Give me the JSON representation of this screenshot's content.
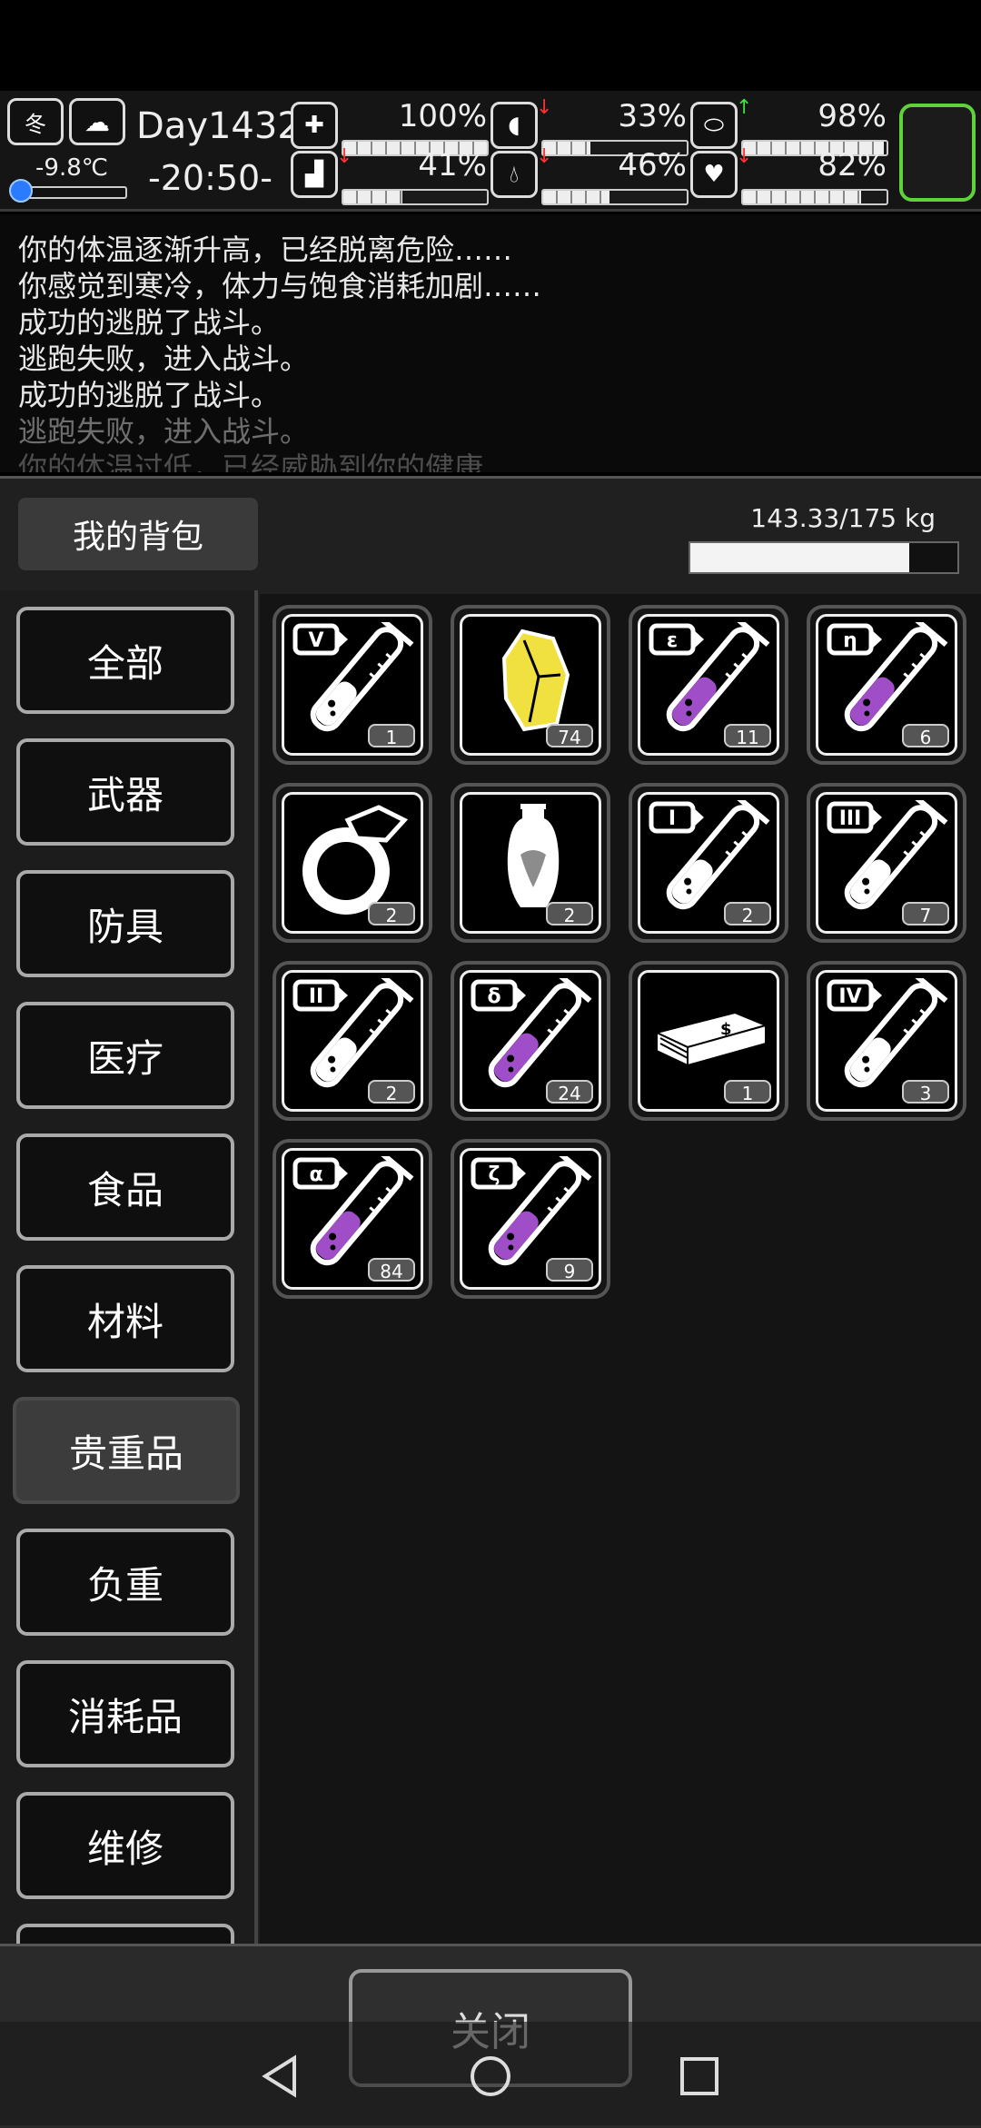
{
  "status": {
    "season_icon": "冬",
    "weather_icon": "cloud-icon",
    "temperature": "-9.8℃",
    "day": "Day1432",
    "time": "-20:50-",
    "health": "100%",
    "hunger": "33%",
    "mood": "98%",
    "stamina": "41%",
    "thirst": "46%",
    "heart": "82%",
    "health_level": 1.0,
    "hunger_level": 0.33,
    "mood_level": 0.98,
    "stamina_level": 0.41,
    "thirst_level": 0.46,
    "heart_level": 0.82
  },
  "log": [
    "你的体温逐渐升高，已经脱离危险……",
    "你感觉到寒冷，体力与饱食消耗加剧……",
    "成功的逃脱了战斗。",
    "逃跑失败，进入战斗。",
    "成功的逃脱了战斗。",
    "逃跑失败，进入战斗。",
    "你的体温过低，已经威胁到你的健康"
  ],
  "bag": {
    "title": "我的背包",
    "weight": "143.33/175 kg",
    "weight_level": 0.82
  },
  "categories": [
    "全部",
    "武器",
    "防具",
    "医疗",
    "食品",
    "材料",
    "贵重品",
    "负重",
    "消耗品",
    "维修"
  ],
  "active_category": "贵重品",
  "items": [
    {
      "name": "potion-v-icon",
      "label": "V",
      "qty": "1",
      "liquid": "#ffffff"
    },
    {
      "name": "crystal-icon",
      "label": "",
      "qty": "74",
      "liquid": "#f0e040"
    },
    {
      "name": "potion-epsilon-icon",
      "label": "ε",
      "qty": "11",
      "liquid": "#a04dc8"
    },
    {
      "name": "potion-eta-icon",
      "label": "η",
      "qty": "6",
      "liquid": "#a04dc8"
    },
    {
      "name": "ring-icon",
      "label": "",
      "qty": "2",
      "liquid": "#ffffff"
    },
    {
      "name": "vase-icon",
      "label": "",
      "qty": "2",
      "liquid": "#ffffff"
    },
    {
      "name": "potion-i-icon",
      "label": "I",
      "qty": "2",
      "liquid": "#ffffff"
    },
    {
      "name": "potion-iii-icon",
      "label": "III",
      "qty": "7",
      "liquid": "#ffffff"
    },
    {
      "name": "potion-ii-icon",
      "label": "II",
      "qty": "2",
      "liquid": "#ffffff"
    },
    {
      "name": "potion-delta-icon",
      "label": "δ",
      "qty": "24",
      "liquid": "#a04dc8"
    },
    {
      "name": "money-stack-icon",
      "label": "",
      "qty": "1",
      "liquid": "#ffffff"
    },
    {
      "name": "potion-iv-icon",
      "label": "IV",
      "qty": "3",
      "liquid": "#ffffff"
    },
    {
      "name": "potion-alpha-icon",
      "label": "α",
      "qty": "84",
      "liquid": "#a04dc8"
    },
    {
      "name": "potion-zeta-icon",
      "label": "ζ",
      "qty": "9",
      "liquid": "#a04dc8"
    }
  ],
  "close_label": "关闭"
}
